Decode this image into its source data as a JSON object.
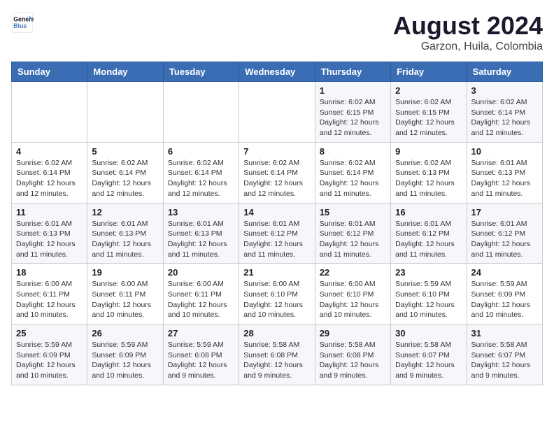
{
  "logo": {
    "line1": "General",
    "line2": "Blue"
  },
  "title": "August 2024",
  "subtitle": "Garzon, Huila, Colombia",
  "days_of_week": [
    "Sunday",
    "Monday",
    "Tuesday",
    "Wednesday",
    "Thursday",
    "Friday",
    "Saturday"
  ],
  "weeks": [
    [
      {
        "day": "",
        "info": ""
      },
      {
        "day": "",
        "info": ""
      },
      {
        "day": "",
        "info": ""
      },
      {
        "day": "",
        "info": ""
      },
      {
        "day": "1",
        "info": "Sunrise: 6:02 AM\nSunset: 6:15 PM\nDaylight: 12 hours\nand 12 minutes."
      },
      {
        "day": "2",
        "info": "Sunrise: 6:02 AM\nSunset: 6:15 PM\nDaylight: 12 hours\nand 12 minutes."
      },
      {
        "day": "3",
        "info": "Sunrise: 6:02 AM\nSunset: 6:14 PM\nDaylight: 12 hours\nand 12 minutes."
      }
    ],
    [
      {
        "day": "4",
        "info": "Sunrise: 6:02 AM\nSunset: 6:14 PM\nDaylight: 12 hours\nand 12 minutes."
      },
      {
        "day": "5",
        "info": "Sunrise: 6:02 AM\nSunset: 6:14 PM\nDaylight: 12 hours\nand 12 minutes."
      },
      {
        "day": "6",
        "info": "Sunrise: 6:02 AM\nSunset: 6:14 PM\nDaylight: 12 hours\nand 12 minutes."
      },
      {
        "day": "7",
        "info": "Sunrise: 6:02 AM\nSunset: 6:14 PM\nDaylight: 12 hours\nand 12 minutes."
      },
      {
        "day": "8",
        "info": "Sunrise: 6:02 AM\nSunset: 6:14 PM\nDaylight: 12 hours\nand 11 minutes."
      },
      {
        "day": "9",
        "info": "Sunrise: 6:02 AM\nSunset: 6:13 PM\nDaylight: 12 hours\nand 11 minutes."
      },
      {
        "day": "10",
        "info": "Sunrise: 6:01 AM\nSunset: 6:13 PM\nDaylight: 12 hours\nand 11 minutes."
      }
    ],
    [
      {
        "day": "11",
        "info": "Sunrise: 6:01 AM\nSunset: 6:13 PM\nDaylight: 12 hours\nand 11 minutes."
      },
      {
        "day": "12",
        "info": "Sunrise: 6:01 AM\nSunset: 6:13 PM\nDaylight: 12 hours\nand 11 minutes."
      },
      {
        "day": "13",
        "info": "Sunrise: 6:01 AM\nSunset: 6:13 PM\nDaylight: 12 hours\nand 11 minutes."
      },
      {
        "day": "14",
        "info": "Sunrise: 6:01 AM\nSunset: 6:12 PM\nDaylight: 12 hours\nand 11 minutes."
      },
      {
        "day": "15",
        "info": "Sunrise: 6:01 AM\nSunset: 6:12 PM\nDaylight: 12 hours\nand 11 minutes."
      },
      {
        "day": "16",
        "info": "Sunrise: 6:01 AM\nSunset: 6:12 PM\nDaylight: 12 hours\nand 11 minutes."
      },
      {
        "day": "17",
        "info": "Sunrise: 6:01 AM\nSunset: 6:12 PM\nDaylight: 12 hours\nand 11 minutes."
      }
    ],
    [
      {
        "day": "18",
        "info": "Sunrise: 6:00 AM\nSunset: 6:11 PM\nDaylight: 12 hours\nand 10 minutes."
      },
      {
        "day": "19",
        "info": "Sunrise: 6:00 AM\nSunset: 6:11 PM\nDaylight: 12 hours\nand 10 minutes."
      },
      {
        "day": "20",
        "info": "Sunrise: 6:00 AM\nSunset: 6:11 PM\nDaylight: 12 hours\nand 10 minutes."
      },
      {
        "day": "21",
        "info": "Sunrise: 6:00 AM\nSunset: 6:10 PM\nDaylight: 12 hours\nand 10 minutes."
      },
      {
        "day": "22",
        "info": "Sunrise: 6:00 AM\nSunset: 6:10 PM\nDaylight: 12 hours\nand 10 minutes."
      },
      {
        "day": "23",
        "info": "Sunrise: 5:59 AM\nSunset: 6:10 PM\nDaylight: 12 hours\nand 10 minutes."
      },
      {
        "day": "24",
        "info": "Sunrise: 5:59 AM\nSunset: 6:09 PM\nDaylight: 12 hours\nand 10 minutes."
      }
    ],
    [
      {
        "day": "25",
        "info": "Sunrise: 5:59 AM\nSunset: 6:09 PM\nDaylight: 12 hours\nand 10 minutes."
      },
      {
        "day": "26",
        "info": "Sunrise: 5:59 AM\nSunset: 6:09 PM\nDaylight: 12 hours\nand 10 minutes."
      },
      {
        "day": "27",
        "info": "Sunrise: 5:59 AM\nSunset: 6:08 PM\nDaylight: 12 hours\nand 9 minutes."
      },
      {
        "day": "28",
        "info": "Sunrise: 5:58 AM\nSunset: 6:08 PM\nDaylight: 12 hours\nand 9 minutes."
      },
      {
        "day": "29",
        "info": "Sunrise: 5:58 AM\nSunset: 6:08 PM\nDaylight: 12 hours\nand 9 minutes."
      },
      {
        "day": "30",
        "info": "Sunrise: 5:58 AM\nSunset: 6:07 PM\nDaylight: 12 hours\nand 9 minutes."
      },
      {
        "day": "31",
        "info": "Sunrise: 5:58 AM\nSunset: 6:07 PM\nDaylight: 12 hours\nand 9 minutes."
      }
    ]
  ]
}
